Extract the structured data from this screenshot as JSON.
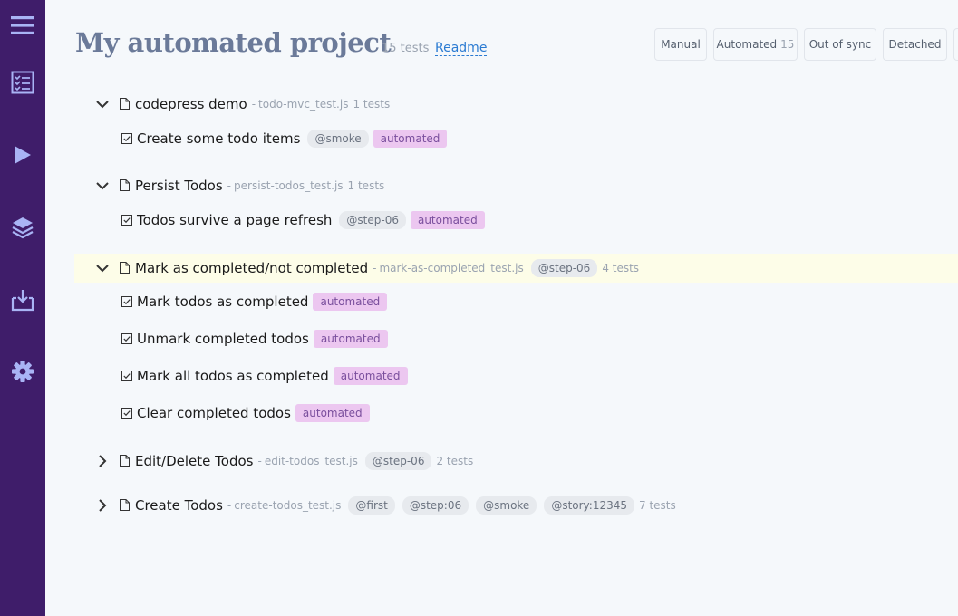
{
  "sidebar": {
    "items": [
      {
        "icon": "menu-icon"
      },
      {
        "icon": "checklist-icon"
      },
      {
        "icon": "play-icon"
      },
      {
        "icon": "layers-icon"
      },
      {
        "icon": "download-icon"
      },
      {
        "icon": "gear-icon"
      }
    ]
  },
  "header": {
    "title": "My automated project",
    "count": "15 tests",
    "readme": "Readme"
  },
  "filters": [
    {
      "label": "Manual",
      "count": ""
    },
    {
      "label": "Automated",
      "count": "15"
    },
    {
      "label": "Out of sync",
      "count": ""
    },
    {
      "label": "Detached",
      "count": ""
    }
  ],
  "suites": [
    {
      "title": "codepress demo",
      "file": "todo-mvc_test.js",
      "tags": [],
      "count": "1 tests",
      "expanded": true,
      "tests": [
        {
          "title": "Create some todo items",
          "tags": [
            "@smoke"
          ],
          "status": "automated"
        }
      ]
    },
    {
      "title": "Persist Todos",
      "file": "persist-todos_test.js",
      "tags": [],
      "count": "1 tests",
      "expanded": true,
      "tests": [
        {
          "title": "Todos survive a page refresh",
          "tags": [
            "@step-06"
          ],
          "status": "automated"
        }
      ]
    },
    {
      "title": "Mark as completed/not completed",
      "file": "mark-as-completed_test.js",
      "tags": [
        "@step-06"
      ],
      "count": "4 tests",
      "expanded": true,
      "tests": [
        {
          "title": "Mark todos as completed",
          "tags": [],
          "status": "automated"
        },
        {
          "title": "Unmark completed todos",
          "tags": [],
          "status": "automated"
        },
        {
          "title": "Mark all todos as completed",
          "tags": [],
          "status": "automated"
        },
        {
          "title": "Clear completed todos",
          "tags": [],
          "status": "automated"
        }
      ]
    },
    {
      "title": "Edit/Delete Todos",
      "file": "edit-todos_test.js",
      "tags": [
        "@step-06"
      ],
      "count": "2 tests",
      "expanded": false,
      "tests": []
    },
    {
      "title": "Create Todos",
      "file": "create-todos_test.js",
      "tags": [
        "@first",
        "@step:06",
        "@smoke",
        "@story:12345"
      ],
      "count": "7 tests",
      "expanded": false,
      "tests": []
    }
  ],
  "colors": {
    "sidebar": "#3f1d6a",
    "sidebar_icon": "#a9b4f5",
    "background": "#f5f8fb",
    "title": "#6b7a99",
    "link": "#2b7bd2",
    "automated_bg": "#ecc7f0",
    "tag_bg": "#e7eaee",
    "highlight": "#fdfde8"
  }
}
